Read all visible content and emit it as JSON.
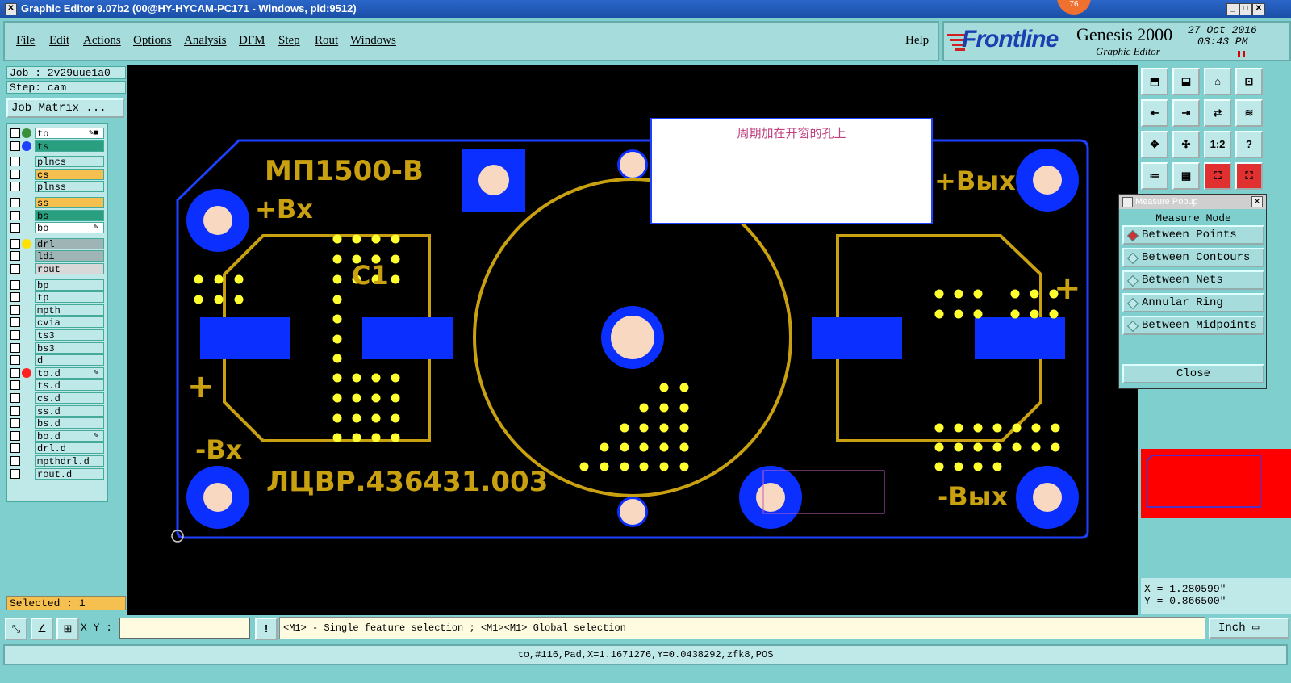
{
  "window": {
    "title": "Graphic Editor 9.07b2 (00@HY-HYCAM-PC171 - Windows, pid:9512)",
    "badge": "76"
  },
  "menu": {
    "file": "File",
    "edit": "Edit",
    "actions": "Actions",
    "options": "Options",
    "analysis": "Analysis",
    "dfm": "DFM",
    "step": "Step",
    "rout": "Rout",
    "windows": "Windows",
    "help": "Help"
  },
  "brand": {
    "logo": "Frontline",
    "product": "Genesis 2000",
    "subtitle": "Graphic Editor",
    "date": "27 Oct 2016",
    "time": "03:43 PM"
  },
  "job": {
    "job_line": "Job : 2v29uue1a0",
    "step_line": "Step: cam",
    "job_matrix": "Job Matrix ..."
  },
  "layers": [
    {
      "name": "to",
      "bg": "#ffffff",
      "dot": "#3a8f3a",
      "mark": "✎■"
    },
    {
      "name": "ts",
      "bg": "#2a9f7f",
      "dot": "#1e40ff",
      "mark": ""
    },
    {
      "name": "plncs",
      "bg": "#bfe8e8",
      "dot": "",
      "mark": ""
    },
    {
      "name": "cs",
      "bg": "#f5c050",
      "dot": "",
      "mark": ""
    },
    {
      "name": "plnss",
      "bg": "#bfe8e8",
      "dot": "",
      "mark": ""
    },
    {
      "name": "ss",
      "bg": "#f5c050",
      "dot": "",
      "mark": ""
    },
    {
      "name": "bs",
      "bg": "#2a9f7f",
      "dot": "",
      "mark": ""
    },
    {
      "name": "bo",
      "bg": "#ffffff",
      "dot": "",
      "mark": "✎"
    },
    {
      "name": "drl",
      "bg": "#9fb5b5",
      "dot": "#ffe000",
      "mark": ""
    },
    {
      "name": "ldi",
      "bg": "#9fb5b5",
      "dot": "",
      "mark": ""
    },
    {
      "name": "rout",
      "bg": "#d8d8d8",
      "dot": "",
      "mark": ""
    },
    {
      "name": "bp",
      "bg": "#bfe8e8",
      "dot": "",
      "mark": ""
    },
    {
      "name": "tp",
      "bg": "#bfe8e8",
      "dot": "",
      "mark": ""
    },
    {
      "name": "mpth",
      "bg": "#bfe8e8",
      "dot": "",
      "mark": ""
    },
    {
      "name": "cvia",
      "bg": "#bfe8e8",
      "dot": "",
      "mark": ""
    },
    {
      "name": "ts3",
      "bg": "#bfe8e8",
      "dot": "",
      "mark": ""
    },
    {
      "name": "bs3",
      "bg": "#bfe8e8",
      "dot": "",
      "mark": ""
    },
    {
      "name": "d",
      "bg": "#bfe8e8",
      "dot": "",
      "mark": ""
    },
    {
      "name": "to.d",
      "bg": "#bfe8e8",
      "dot": "#ff2020",
      "mark": "✎"
    },
    {
      "name": "ts.d",
      "bg": "#bfe8e8",
      "dot": "",
      "mark": ""
    },
    {
      "name": "cs.d",
      "bg": "#bfe8e8",
      "dot": "",
      "mark": ""
    },
    {
      "name": "ss.d",
      "bg": "#bfe8e8",
      "dot": "",
      "mark": ""
    },
    {
      "name": "bs.d",
      "bg": "#bfe8e8",
      "dot": "",
      "mark": ""
    },
    {
      "name": "bo.d",
      "bg": "#bfe8e8",
      "dot": "",
      "mark": "✎"
    },
    {
      "name": "drl.d",
      "bg": "#bfe8e8",
      "dot": "",
      "mark": ""
    },
    {
      "name": "mpthdrl.d",
      "bg": "#bfe8e8",
      "dot": "",
      "mark": ""
    },
    {
      "name": "rout.d",
      "bg": "#bfe8e8",
      "dot": "",
      "mark": ""
    }
  ],
  "selected": "Selected : 1",
  "board": {
    "text_part": "МП1500-В",
    "text_c1": "C1",
    "text_vx_plus": "+Вх",
    "text_vx_minus": "-Вх",
    "text_vyh_plus": "+Вых",
    "text_vyh_minus": "-Вых",
    "text_doc": "ЛЦВР.436431.003",
    "plus_left": "+",
    "plus_right": "+",
    "note": "周期加在开窗的孔上",
    "color_outline": "#1e40ff",
    "color_silk": "#c8a010",
    "color_pad": "#0a2fff",
    "color_hole": "#f8d8c0",
    "color_drill": "#ffff30"
  },
  "tools": [
    "⬒",
    "⬓",
    "⌂",
    "⊡",
    "⇤",
    "⇥",
    "⇄",
    "≋",
    "✥",
    "✣",
    "1:2",
    "?",
    "≔",
    "▦",
    "⛶",
    "⛶"
  ],
  "measure": {
    "title": "Measure Popup",
    "mode_label": "Measure Mode",
    "options": [
      "Between Points",
      "Between Contours",
      "Between Nets",
      "Annular Ring",
      "Between Midpoints"
    ],
    "active": 0,
    "close": "Close"
  },
  "coords": {
    "x": "X = 1.280599\"",
    "y": "Y = 0.866500\""
  },
  "bottom": {
    "xy_label": "X Y :",
    "xy_value": "",
    "bang": "!",
    "hint": "<M1> - Single feature selection ; <M1><M1> Global selection",
    "units": "Inch ▭"
  },
  "status": "to,#116,Pad,X=1.1671276,Y=0.0438292,zfk8,POS"
}
